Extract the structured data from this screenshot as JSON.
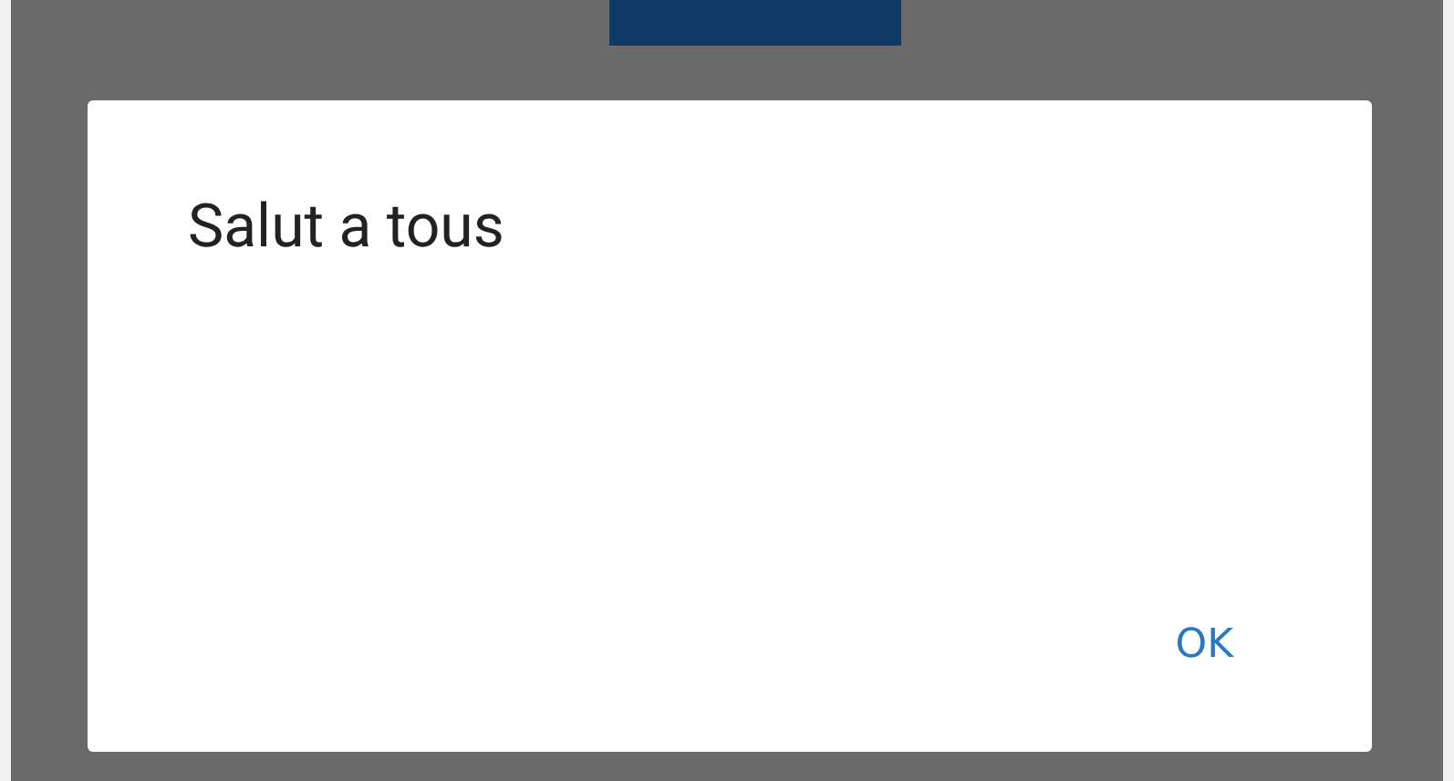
{
  "dialog": {
    "title": "Salut a tous",
    "buttons": [
      "OK"
    ]
  }
}
